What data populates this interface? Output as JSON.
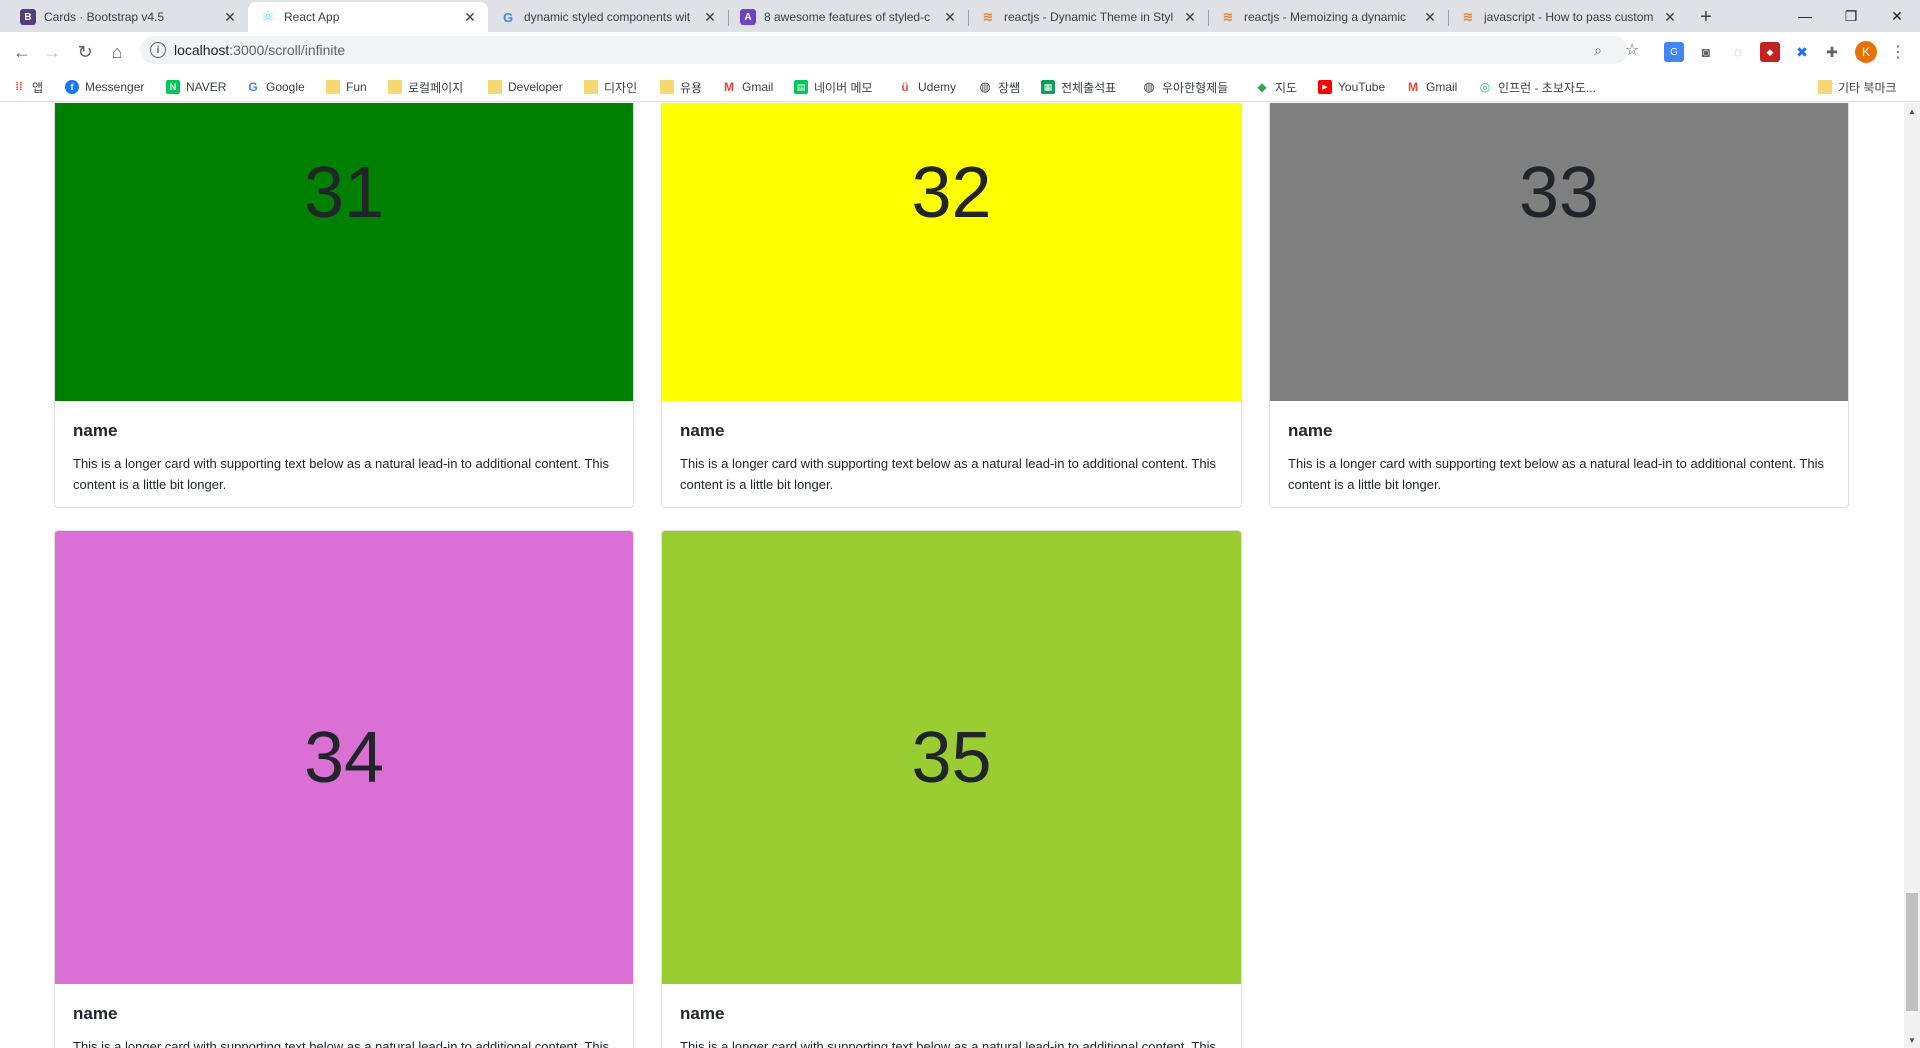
{
  "tabs": [
    {
      "title": "Cards · Bootstrap v4.5",
      "favicon": "bootstrap-icon",
      "active": false
    },
    {
      "title": "React App",
      "favicon": "react-icon",
      "active": true
    },
    {
      "title": "dynamic styled components wit",
      "favicon": "google-icon",
      "active": false
    },
    {
      "title": "8 awesome features of styled-c",
      "favicon": "styled-components-icon",
      "active": false
    },
    {
      "title": "reactjs - Dynamic Theme in Styl",
      "favicon": "stackoverflow-icon",
      "active": false
    },
    {
      "title": "reactjs - Memoizing a dynamic",
      "favicon": "stackoverflow-icon",
      "active": false
    },
    {
      "title": "javascript - How to pass custom",
      "favicon": "stackoverflow-icon",
      "active": false
    }
  ],
  "address": {
    "host": "localhost",
    "path": ":3000/scroll/infinite"
  },
  "bookmarks": [
    {
      "label": "앱",
      "icon": "apps-grid-icon"
    },
    {
      "label": "Messenger",
      "icon": "facebook-icon"
    },
    {
      "label": "NAVER",
      "icon": "naver-icon"
    },
    {
      "label": "Google",
      "icon": "google-icon"
    },
    {
      "label": "Fun",
      "icon": "folder-icon"
    },
    {
      "label": "로컬페이지",
      "icon": "folder-icon"
    },
    {
      "label": "Developer",
      "icon": "folder-icon"
    },
    {
      "label": "디자인",
      "icon": "folder-icon"
    },
    {
      "label": "유용",
      "icon": "folder-icon"
    },
    {
      "label": "Gmail",
      "icon": "gmail-icon"
    },
    {
      "label": "네이버 메모",
      "icon": "naver-memo-icon"
    },
    {
      "label": "Udemy",
      "icon": "udemy-icon"
    },
    {
      "label": "장쌤",
      "icon": "globe-icon"
    },
    {
      "label": "전체출석표",
      "icon": "sheets-icon"
    },
    {
      "label": "우아한형제들",
      "icon": "globe-icon"
    },
    {
      "label": "지도",
      "icon": "maps-icon"
    },
    {
      "label": "YouTube",
      "icon": "youtube-icon"
    },
    {
      "label": "Gmail",
      "icon": "gmail-icon"
    },
    {
      "label": "인프런 - 초보자도...",
      "icon": "inflearn-icon"
    }
  ],
  "other_bookmarks": "기타 북마크",
  "profile_initial": "K",
  "cards": [
    {
      "number": "31",
      "color": "#008000",
      "title": "name",
      "text": "This is a longer card with supporting text below as a natural lead-in to additional content. This content is a little bit longer."
    },
    {
      "number": "32",
      "color": "#ffff00",
      "title": "name",
      "text": "This is a longer card with supporting text below as a natural lead-in to additional content. This content is a little bit longer."
    },
    {
      "number": "33",
      "color": "#808080",
      "title": "name",
      "text": "This is a longer card with supporting text below as a natural lead-in to additional content. This content is a little bit longer."
    },
    {
      "number": "34",
      "color": "#da70d6",
      "title": "name",
      "text": "This is a longer card with supporting text below as a natural lead-in to additional content. This content is a little bit longer."
    },
    {
      "number": "35",
      "color": "#9acd32",
      "title": "name",
      "text": "This is a longer card with supporting text below as a natural lead-in to additional content. This content is a little bit longer."
    }
  ]
}
